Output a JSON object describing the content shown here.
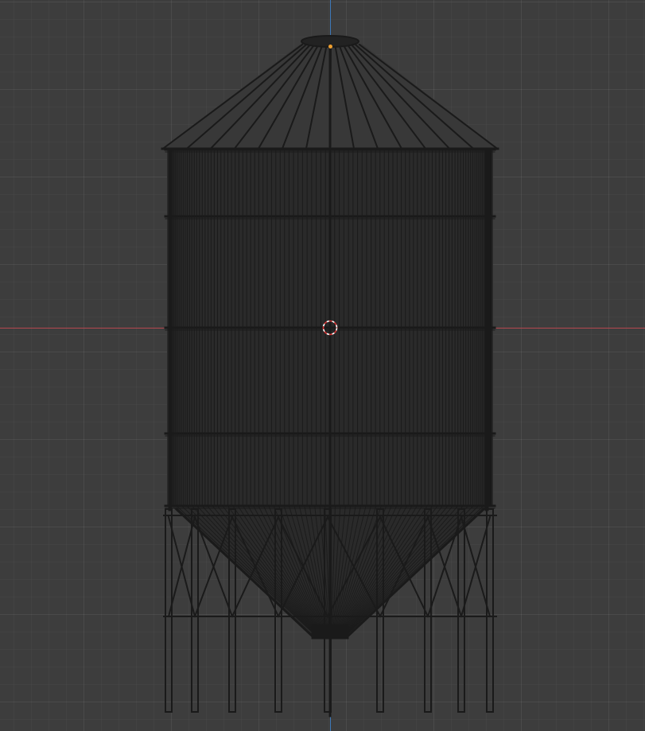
{
  "viewport": {
    "background_color": "#3d3d3d",
    "grid_color": "#4a4a4a"
  },
  "axes": {
    "x_axis_color": "#b5474f",
    "z_axis_color": "#3d78b8"
  },
  "object": {
    "kind": "grain silo wireframe",
    "wire_color": "#1a1a1a",
    "fill_color": "#2a2a2a"
  },
  "scene": {
    "cursor_icon": "3d-cursor-icon",
    "origin_color": "#f0a030"
  }
}
